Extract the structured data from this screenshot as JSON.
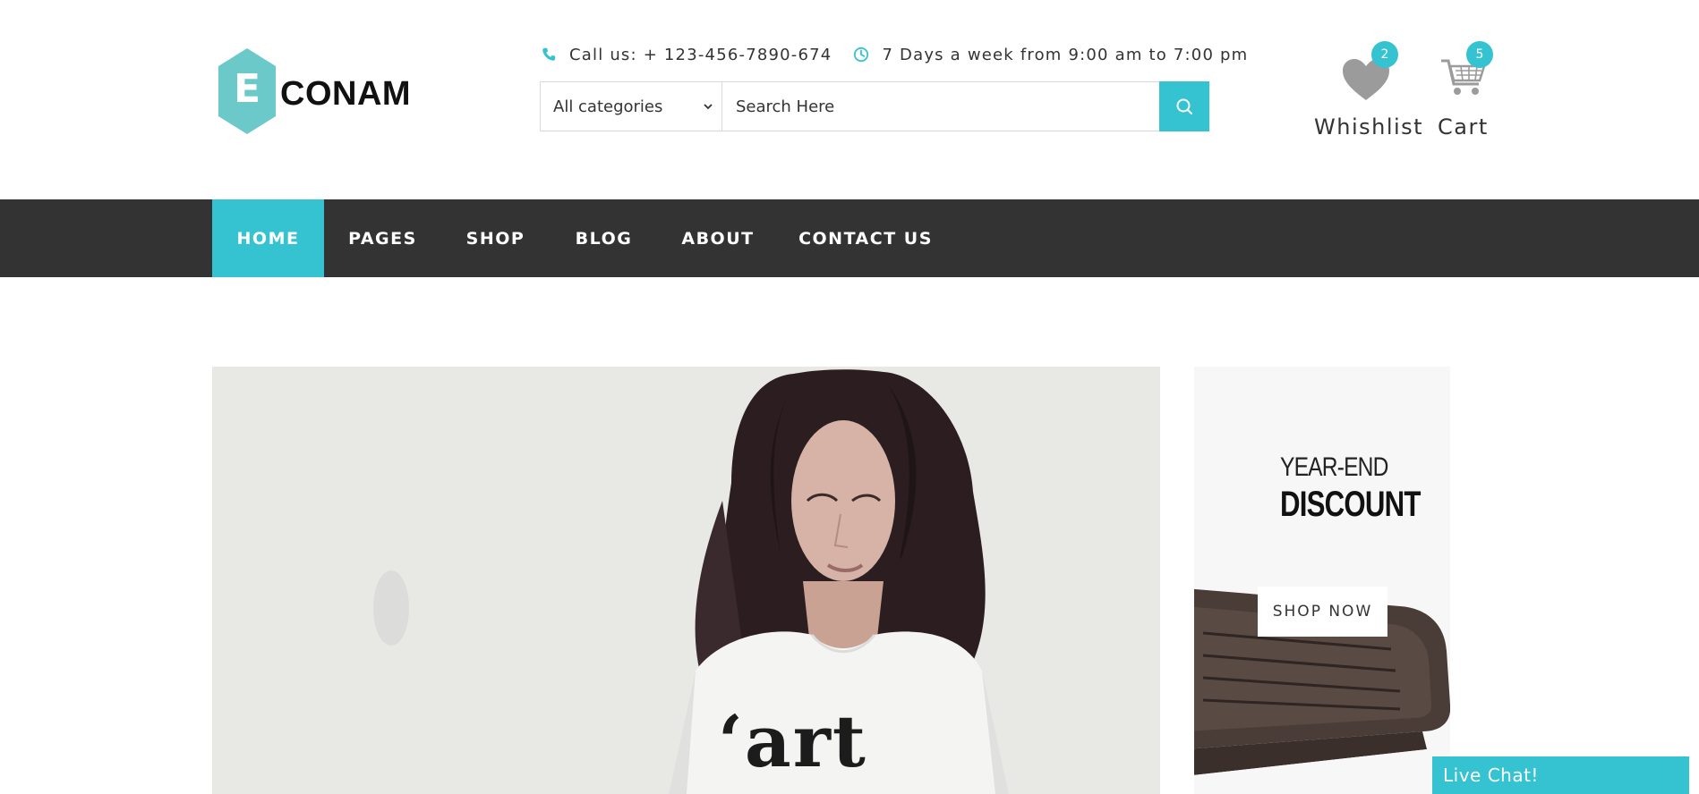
{
  "brand": {
    "logo_letter": "E",
    "logo_word": "CONAM",
    "accent_color": "#35c3d1"
  },
  "header": {
    "phone_icon": "phone-icon",
    "phone_text": "Call us: + 123-456-7890-674",
    "clock_icon": "clock-icon",
    "hours_text": "7 Days a week from 9:00 am to 7:00 pm"
  },
  "search": {
    "category_selected": "All categories",
    "placeholder": "Search Here",
    "button_icon": "search-icon"
  },
  "wishlist": {
    "label": "Whishlist",
    "count": "2",
    "icon": "heart-icon"
  },
  "cart": {
    "label": "Cart",
    "count": "5",
    "icon": "cart-icon"
  },
  "nav": {
    "items": [
      {
        "label": "HOME",
        "active": true
      },
      {
        "label": "PAGES"
      },
      {
        "label": "SHOP"
      },
      {
        "label": "BLOG"
      },
      {
        "label": "ABOUT"
      },
      {
        "label": "CONTACT US"
      }
    ],
    "bar_color": "#333333"
  },
  "hero": {
    "shirt_text": "‘art"
  },
  "side_banner": {
    "line1": "YEAR-END",
    "line2": "DISCOUNT",
    "button_label": "SHOP NOW"
  },
  "live_chat": {
    "label": "Live Chat!"
  }
}
